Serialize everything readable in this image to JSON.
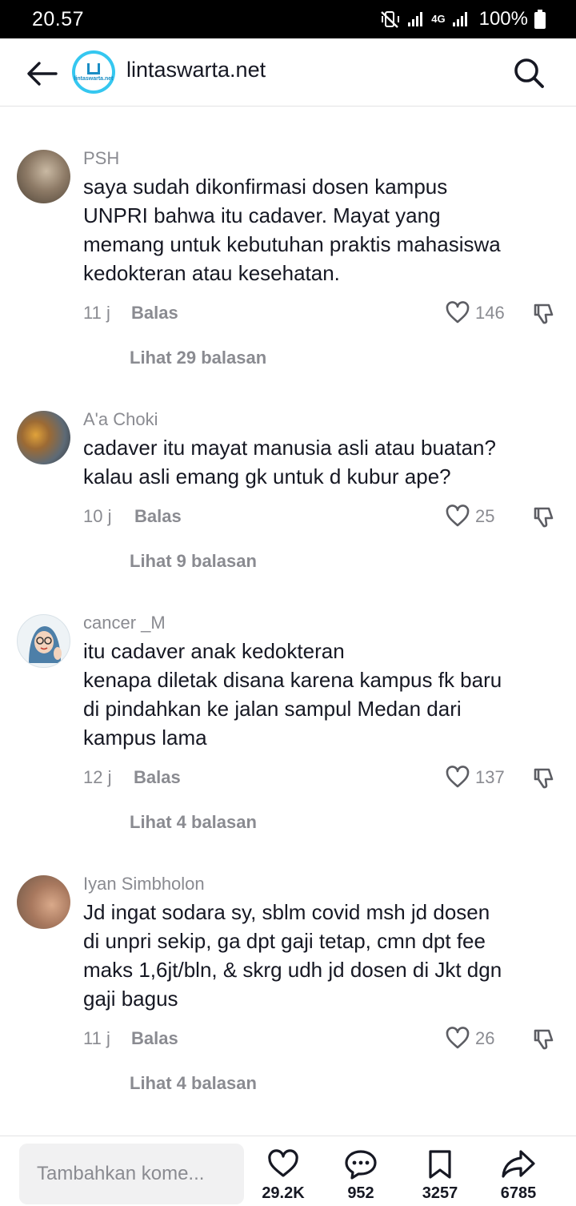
{
  "status_bar": {
    "time": "20.57",
    "battery": "100%",
    "network": "4G"
  },
  "header": {
    "site_name": "lintaswarta.net",
    "logo_text": "lintaswarta.net"
  },
  "comments": [
    {
      "username": "PSH",
      "text": "saya sudah dikonfirmasi dosen kampus\nUNPRI bahwa itu cadaver. Mayat yang\nmemang untuk kebutuhan praktis mahasiswa\nkedokteran atau kesehatan.",
      "time": "11 j",
      "reply_label": "Balas",
      "likes": "146",
      "view_replies": "Lihat 29 balasan"
    },
    {
      "username": "A'a Choki",
      "text": "cadaver itu mayat manusia asli atau buatan?\nkalau asli emang gk untuk d kubur ape?",
      "time": "10 j",
      "reply_label": "Balas",
      "likes": "25",
      "view_replies": "Lihat 9 balasan"
    },
    {
      "username": "cancer _M",
      "text": "itu cadaver anak kedokteran\nkenapa diletak disana karena kampus fk baru\ndi pindahkan ke jalan sampul Medan dari\nkampus lama",
      "time": "12 j",
      "reply_label": "Balas",
      "likes": "137",
      "view_replies": "Lihat 4 balasan"
    },
    {
      "username": "Iyan Simbholon",
      "text": "Jd ingat sodara sy, sblm covid msh jd dosen\ndi unpri sekip, ga dpt gaji tetap, cmn dpt fee\nmaks 1,6jt/bln, & skrg udh jd dosen di Jkt dgn\ngaji bagus",
      "time": "11 j",
      "reply_label": "Balas",
      "likes": "26",
      "view_replies": "Lihat 4 balasan"
    }
  ],
  "bottom_bar": {
    "input_placeholder": "Tambahkan kome...",
    "likes": "29.2K",
    "comments": "952",
    "saves": "3257",
    "shares": "6785"
  },
  "colors": {
    "text": "#161823",
    "muted": "#8a8b91",
    "logo_bg": "#35c7f0"
  }
}
